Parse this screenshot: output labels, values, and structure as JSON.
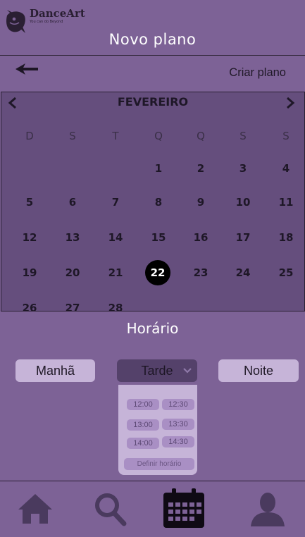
{
  "app": {
    "logo_name": "DanceArt",
    "logo_tagline": "You can do Beyond"
  },
  "header": {
    "title": "Novo plano"
  },
  "subbar": {
    "action_label": "Criar plano"
  },
  "calendar": {
    "month": "FEVEREIRO",
    "weekdays": [
      "D",
      "S",
      "T",
      "Q",
      "Q",
      "S",
      "S"
    ],
    "weeks": [
      [
        "",
        "",
        "",
        "1",
        "2",
        "3",
        "4"
      ],
      [
        "5",
        "6",
        "7",
        "8",
        "9",
        "10",
        "11"
      ],
      [
        "12",
        "13",
        "14",
        "15",
        "16",
        "17",
        "18"
      ],
      [
        "19",
        "20",
        "21",
        "22",
        "23",
        "24",
        "25"
      ],
      [
        "26",
        "27",
        "28",
        "",
        "",
        "",
        ""
      ]
    ],
    "selected_day": "22"
  },
  "schedule": {
    "title": "Horário",
    "periods": {
      "morning": "Manhã",
      "afternoon": "Tarde",
      "night": "Noite"
    },
    "selected_period": "Tarde",
    "times": [
      "12:00",
      "12:30",
      "13:00",
      "13:30",
      "14:00",
      "14:30"
    ],
    "define_label": "Definir horário"
  },
  "nav": {
    "items": [
      "home-icon",
      "search-icon",
      "calendar-icon",
      "profile-icon"
    ],
    "active": "calendar-icon"
  },
  "colors": {
    "background": "#7d6296",
    "calendar_bg": "#654e7d",
    "button_light": "#c6b4d8",
    "button_active": "#54416a",
    "icon_dark": "#2a1f33"
  }
}
